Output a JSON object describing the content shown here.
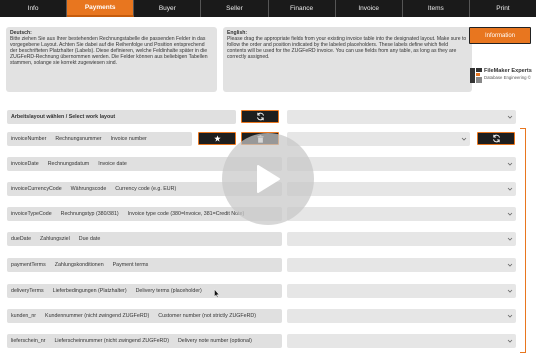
{
  "tabs": [
    {
      "label": "Info",
      "active": false
    },
    {
      "label": "Payments",
      "active": true
    },
    {
      "label": "Buyer",
      "active": false
    },
    {
      "label": "Seller",
      "active": false
    },
    {
      "label": "Finance",
      "active": false
    },
    {
      "label": "Invoice",
      "active": false
    },
    {
      "label": "Items",
      "active": false
    },
    {
      "label": "Print",
      "active": false
    }
  ],
  "help": {
    "de_title": "Deutsch:",
    "de_text": "Bitte ziehen Sie aus Ihrer bestehenden Rechnungstabelle die passenden Felder in das vorgegebene Layout. Achten Sie dabei auf die Reihenfolge und Position entsprechend der beschrifteten Platzhalter (Labels). Diese definieren, welche Feldinhalte später in die ZUGFeRD-Rechnung übernommen werden. Die Felder können aus beliebigen Tabellen stammen, solange sie korrekt zugewiesen sind.",
    "en_title": "English:",
    "en_text": "Please drag the appropriate fields from your existing invoice table into the designated layout. Make sure to follow the order and position indicated by the labeled placeholders. These labels define which field contents will be used for the ZUGFeRD invoice. You can use fields from any table, as long as they are correctly assigned."
  },
  "info_button": "Information",
  "logo": {
    "line1": "FileMaker Experts",
    "line2": "Database Engineering ©"
  },
  "layout_select": {
    "label": "Arbeitslayout wählen / Select work layout"
  },
  "rows": [
    {
      "field": "invoiceNumber",
      "de": "Rechnungsnummer",
      "en": "Invoice number"
    },
    {
      "field": "invoiceDate",
      "de": "Rechnungsdatum",
      "en": "Invoice date"
    },
    {
      "field": "invoiceCurrencyCode",
      "de": "Währungscode",
      "en": "Currency code (e.g. EUR)"
    },
    {
      "field": "invoiceTypeCode",
      "de": "Rechnungstyp (380/381)",
      "en": "Invoice type code (380=Invoice, 381=Credit Note)"
    },
    {
      "field": "dueDate",
      "de": "Zahlungsziel",
      "en": "Due date"
    },
    {
      "field": "paymentTerms",
      "de": "Zahlungskonditionen",
      "en": "Payment terms"
    },
    {
      "field": "deliveryTerms",
      "de": "Lieferbedingungen (Platzhalter)",
      "en": "Delivery terms (placeholder)"
    },
    {
      "field": "kunden_nr",
      "de": "Kundennummer (nicht zwingend ZUGFeRD)",
      "en": "Customer number (not strictly ZUGFeRD)"
    },
    {
      "field": "lieferschein_nr",
      "de": "Lieferscheinnummer (nicht zwingend ZUGFeRD)",
      "en": "Delivery note number (optional)"
    }
  ],
  "icons": {
    "refresh": "refresh-icon",
    "star": "star-icon",
    "trash": "trash-icon",
    "play": "play-icon",
    "chevron": "chevron-down-icon"
  },
  "colors": {
    "accent": "#e8761f",
    "tabbar": "#1a1a1a",
    "field_bg": "#e0e0e0",
    "button_dark": "#1e1e1e"
  }
}
